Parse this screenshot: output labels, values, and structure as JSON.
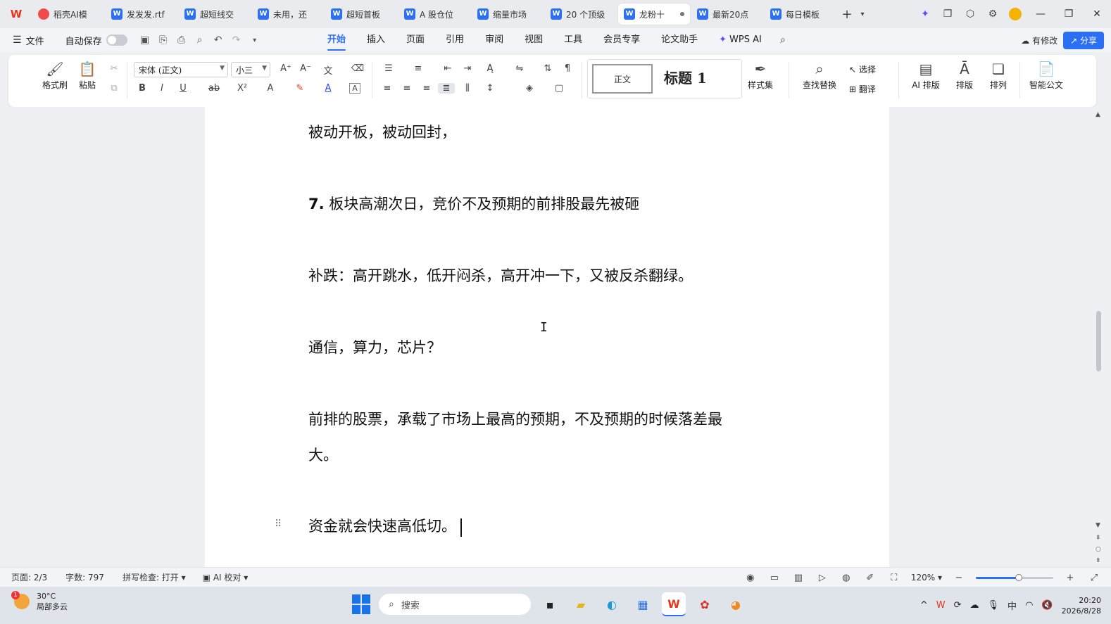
{
  "titlebar": {
    "tabs": [
      {
        "label": "稻壳AI模",
        "icon": "docer-ai-icon",
        "active": false
      },
      {
        "label": "发发发.rtf",
        "icon": "word-doc-icon",
        "active": false
      },
      {
        "label": "超短线交",
        "icon": "word-doc-icon",
        "active": false
      },
      {
        "label": "未用，还",
        "icon": "word-doc-icon",
        "active": false
      },
      {
        "label": "超短首板",
        "icon": "word-doc-icon",
        "active": false
      },
      {
        "label": "A 股仓位",
        "icon": "word-doc-icon",
        "active": false
      },
      {
        "label": "缩量市场",
        "icon": "word-doc-icon",
        "active": false
      },
      {
        "label": "20 个顶级",
        "icon": "word-doc-icon",
        "active": false
      },
      {
        "label": "龙粉十",
        "icon": "word-doc-icon",
        "active": true
      },
      {
        "label": "最新20点",
        "icon": "word-doc-icon",
        "active": false
      },
      {
        "label": "每日模板",
        "icon": "word-doc-icon",
        "active": false
      }
    ],
    "add_tab": "+",
    "doc_icon_letter": "W"
  },
  "menubar": {
    "file": "文件",
    "autosave": "自动保存",
    "tabs": [
      "开始",
      "插入",
      "页面",
      "引用",
      "审阅",
      "视图",
      "工具",
      "会员专享",
      "论文助手",
      "WPS AI"
    ],
    "active_tab": "开始",
    "modify": "有修改",
    "share": "分享"
  },
  "ribbon": {
    "format_painter": "格式刷",
    "paste": "粘贴",
    "font_name": "宋体 (正文)",
    "font_size": "小三",
    "style_normal": "正文",
    "style_heading": "标题 1",
    "style_set": "样式集",
    "find_replace": "查找替换",
    "select": "选择",
    "translate": "翻译",
    "ai_layout": "AI 排版",
    "layout": "排版",
    "arrange": "排列",
    "smart_doc": "智能公文",
    "bold": "B",
    "italic": "I",
    "underline": "U"
  },
  "document": {
    "paragraphs": [
      "被动开板，被动回封，",
      "板块高潮次日，竞价不及预期的前排股最先被砸",
      "补跌：高开跳水，低开闷杀，高开冲一下，又被反杀翻绿。",
      "通信，算力，芯片？",
      "前排的股票，承载了市场上最高的预期，不及预期的时候落差最",
      "大。",
      "资金就会快速高低切。"
    ],
    "heading_number": "7."
  },
  "statusbar": {
    "page": "页面: 2/3",
    "words": "字数: 797",
    "spellcheck": "拼写检查: 打开",
    "ai_proof": "AI 校对",
    "zoom": "120%",
    "zoom_level_fraction": 0.55
  },
  "taskbar": {
    "weather_temp": "30°C",
    "weather_desc": "局部多云",
    "weather_badge": "1",
    "search_placeholder": "搜索",
    "ime": "中",
    "time": "20:20",
    "date": "2026/8/28"
  },
  "colors": {
    "accent": "#2b6ff5",
    "wps_red": "#e8341c"
  }
}
